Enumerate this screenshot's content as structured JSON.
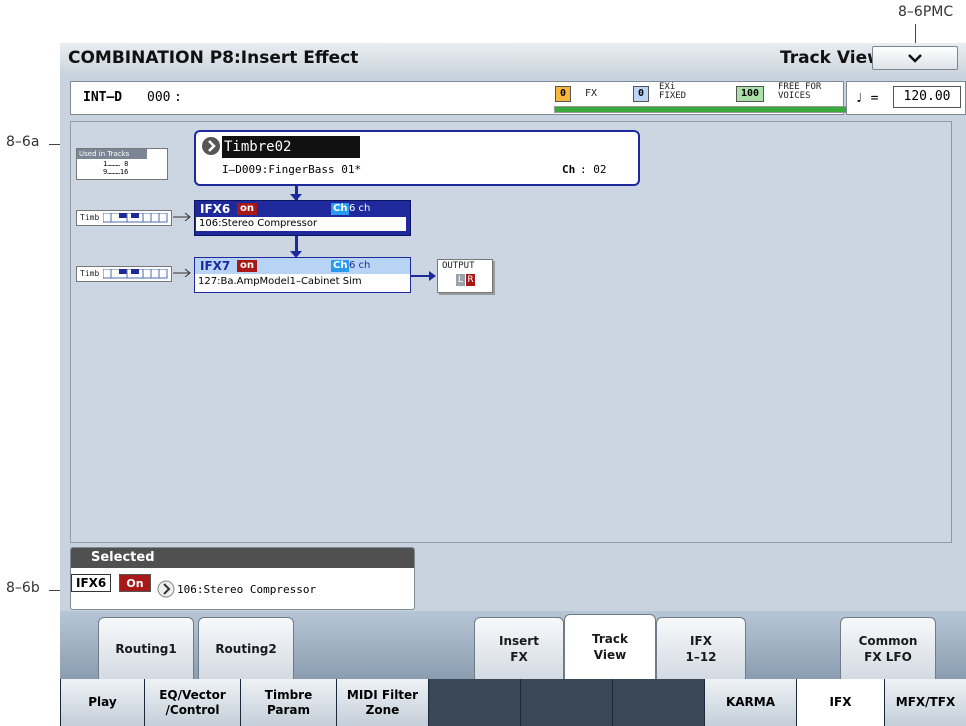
{
  "callouts": {
    "pmc": "8–6PMC",
    "a": "8–6a",
    "b": "8–6b"
  },
  "header": {
    "title": "COMBINATION P8:Insert Effect",
    "page": "Track View",
    "menu_icon": "chevron-down-icon"
  },
  "info": {
    "combi_bank": "INT–D",
    "combi_number": "000",
    "combi_name": ":",
    "fx_count": "0",
    "fx_label": "FX",
    "exi_count": "0",
    "exi_label_top": "EXi",
    "exi_label_bottom": "FIXED",
    "free_count": "100",
    "free_label_top": "FREE FOR",
    "free_label_bottom": "VOICES",
    "voice_meter_percent": 100,
    "tempo_symbol": "♩ =",
    "tempo": "120.00"
  },
  "routing": {
    "used_in_tracks_label": "Used in Tracks",
    "track_range_low": "1……… 8",
    "track_range_high": "9………16",
    "timbre_label": "Timbre02",
    "program": "I–D009:FingerBass 01*",
    "ch_label": "Ch",
    "ch_value": ": 02",
    "ifx6": {
      "name": "IFX6",
      "state": "on",
      "ch_badge": "Ch",
      "ch_value": "6 ch",
      "effect": "106:Stereo Compressor",
      "timb_label": "Timb"
    },
    "ifx7": {
      "name": "IFX7",
      "state": "on",
      "ch_badge": "Ch",
      "ch_value": "6 ch",
      "effect": "127:Ba.AmpModel1–Cabinet Sim",
      "timb_label": "Timb"
    },
    "output": {
      "label": "OUTPUT",
      "l": "L",
      "r": "R"
    }
  },
  "selected": {
    "header": "Selected",
    "ifx": "IFX6",
    "state": "On",
    "effect": "106:Stereo Compressor"
  },
  "page_tabs": [
    {
      "line1": "Routing1",
      "line2": ""
    },
    {
      "line1": "Routing2",
      "line2": ""
    },
    {
      "line1": "Insert",
      "line2": "FX"
    },
    {
      "line1": "Track",
      "line2": "View"
    },
    {
      "line1": "IFX",
      "line2": "1–12"
    },
    {
      "line1": "Common",
      "line2": "FX LFO"
    }
  ],
  "mode_tabs": [
    {
      "line1": "Play",
      "line2": ""
    },
    {
      "line1": "EQ/Vector",
      "line2": "/Control"
    },
    {
      "line1": "Timbre",
      "line2": "Param"
    },
    {
      "line1": "MIDI Filter",
      "line2": "Zone"
    },
    {
      "line1": "",
      "line2": ""
    },
    {
      "line1": "",
      "line2": ""
    },
    {
      "line1": "",
      "line2": ""
    },
    {
      "line1": "KARMA",
      "line2": ""
    },
    {
      "line1": "IFX",
      "line2": ""
    },
    {
      "line1": "MFX/TFX",
      "line2": ""
    }
  ],
  "colors": {
    "accent_blue": "#1e2a9c",
    "on_red": "#a81818",
    "meter_green": "#3aa83a",
    "fx_orange": "#f7b73c"
  }
}
